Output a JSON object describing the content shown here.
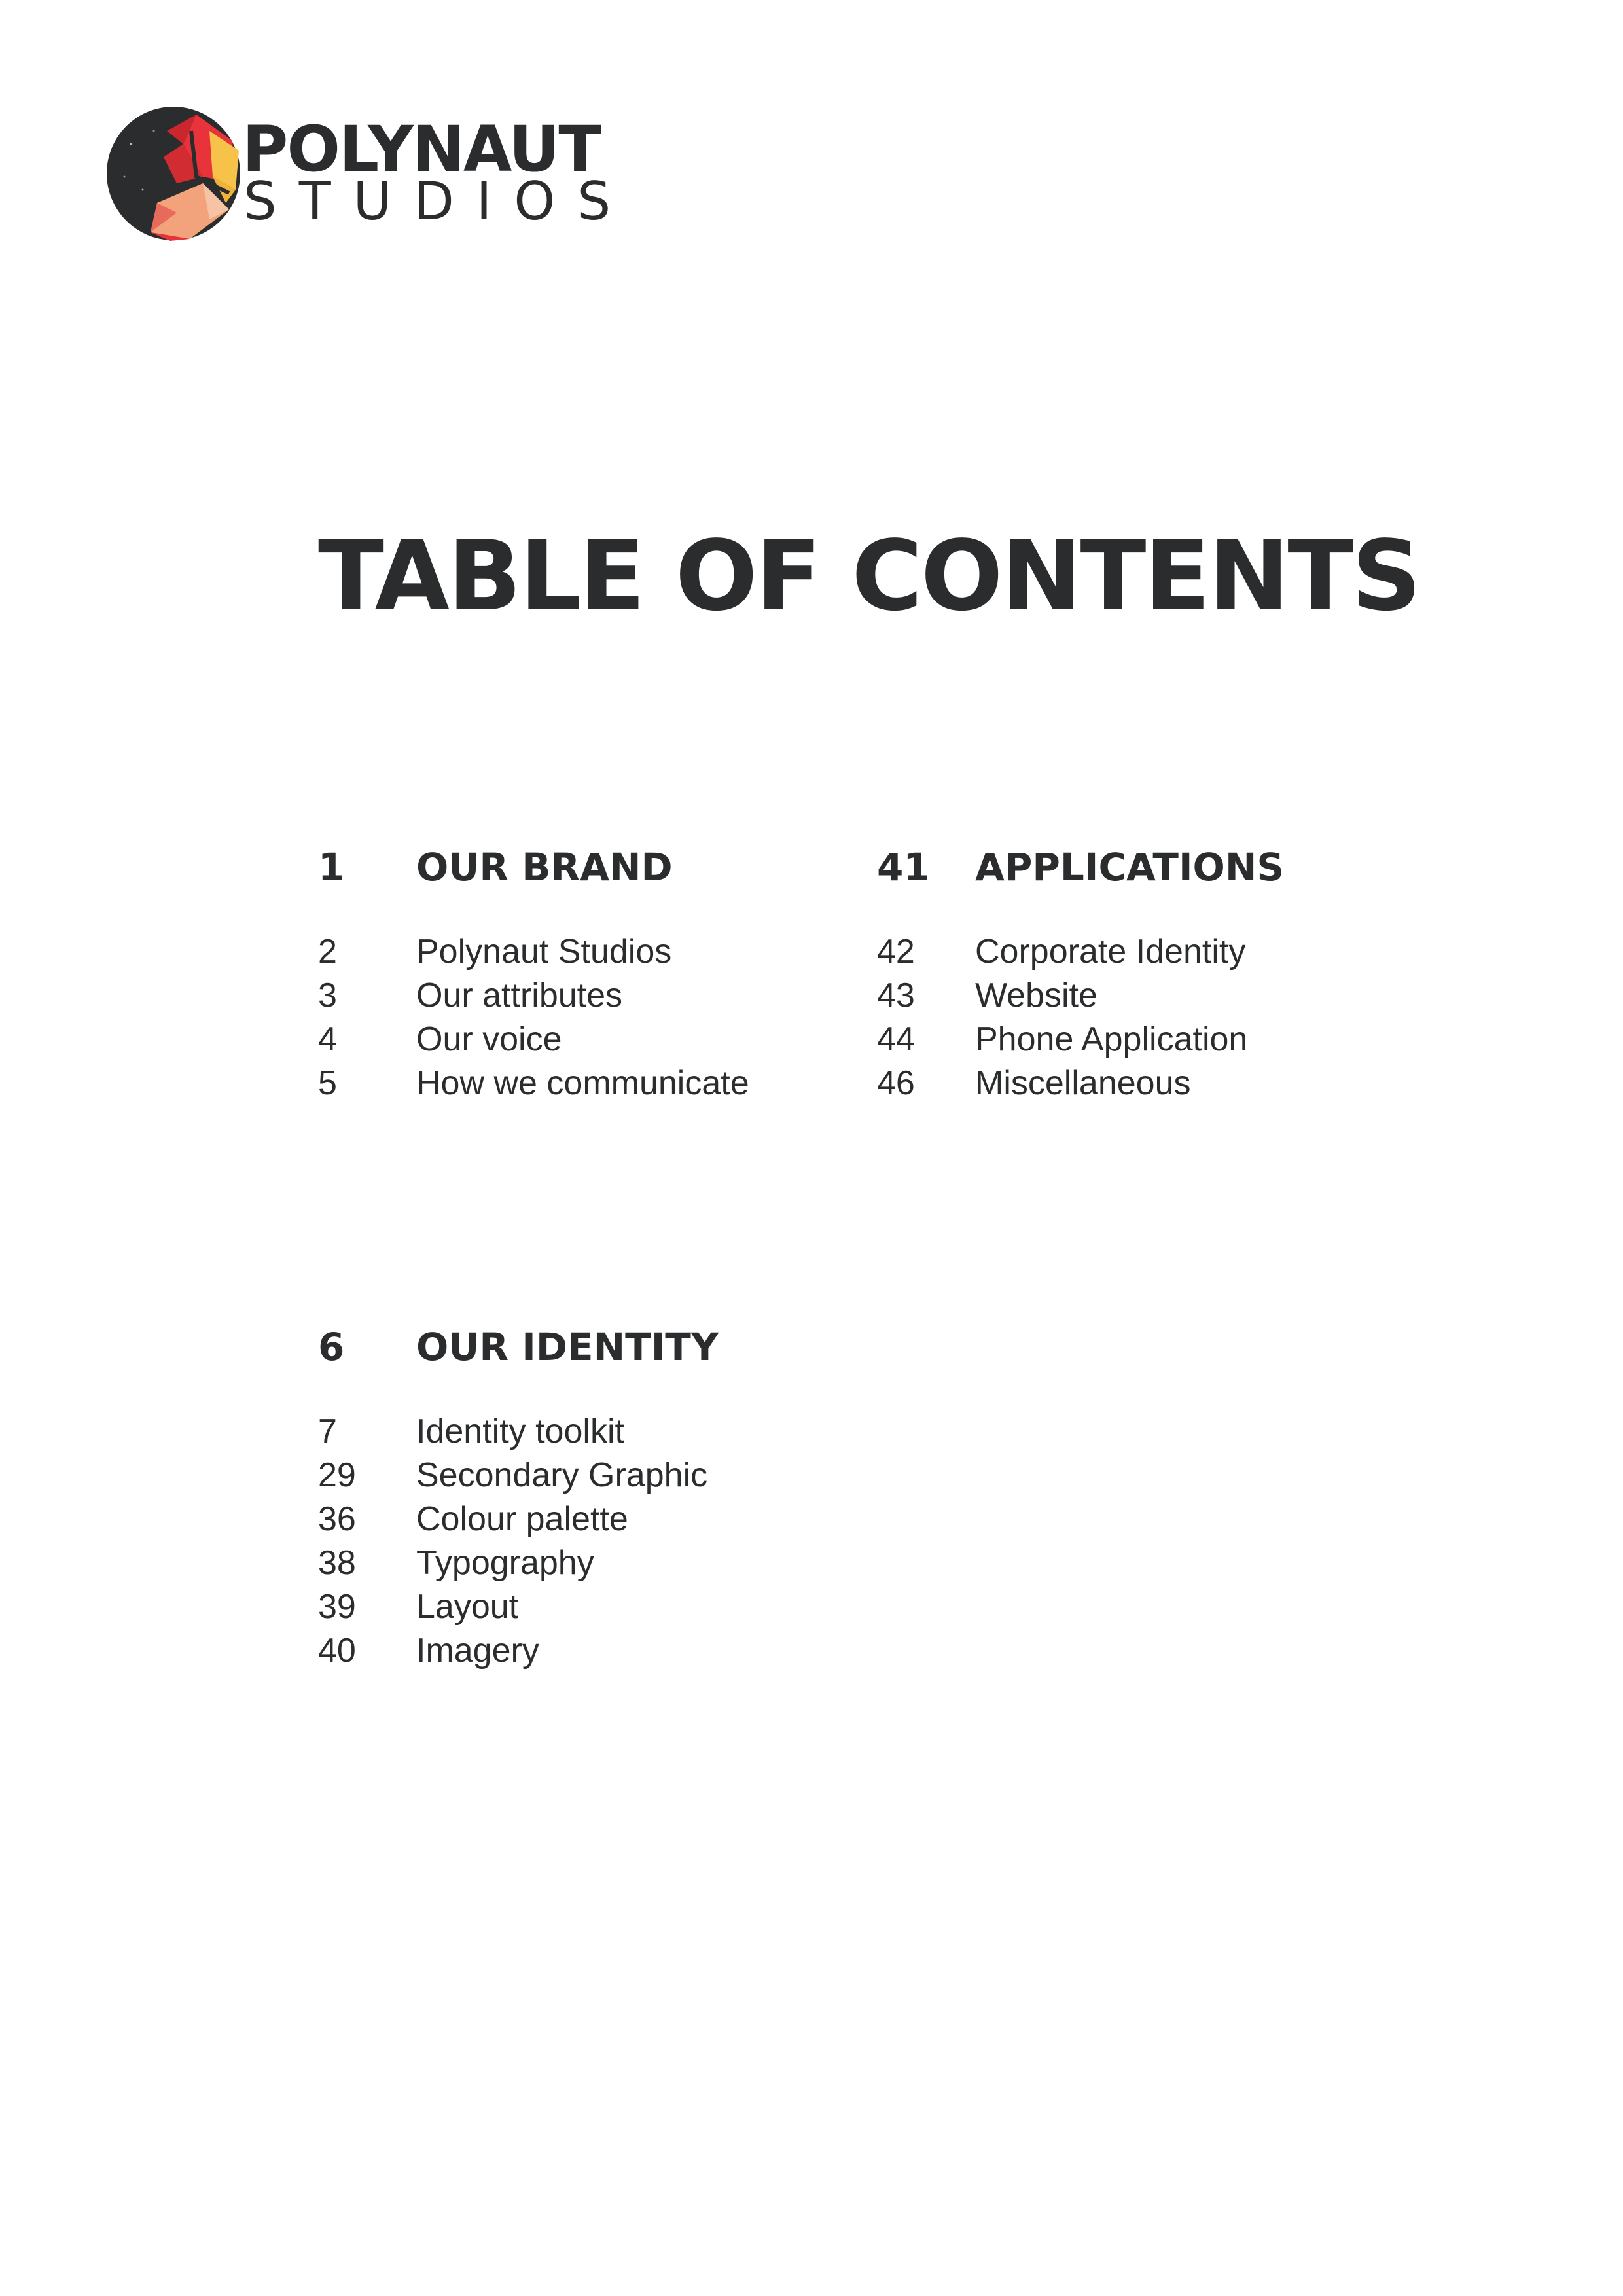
{
  "brand": {
    "name_line1": "POLYNAUT",
    "name_line2": "STUDIOS",
    "colors": {
      "dark": "#2a2c2e",
      "red": "#e8333a",
      "yellow": "#f7c24a",
      "peach": "#f2a37c"
    }
  },
  "title": "TABLE OF CONTENTS",
  "sections": [
    {
      "page": "1",
      "title": "OUR BRAND",
      "items": [
        {
          "page": "2",
          "label": "Polynaut Studios"
        },
        {
          "page": "3",
          "label": "Our attributes"
        },
        {
          "page": "4",
          "label": "Our voice"
        },
        {
          "page": "5",
          "label": "How we communicate"
        }
      ]
    },
    {
      "page": "41",
      "title": "APPLICATIONS",
      "items": [
        {
          "page": "42",
          "label": "Corporate Identity"
        },
        {
          "page": "43",
          "label": "Website"
        },
        {
          "page": "44",
          "label": "Phone Application"
        },
        {
          "page": "46",
          "label": "Miscellaneous"
        }
      ]
    },
    {
      "page": "6",
      "title": "OUR IDENTITY",
      "items": [
        {
          "page": "7",
          "label": "Identity toolkit"
        },
        {
          "page": "29",
          "label": "Secondary Graphic"
        },
        {
          "page": "36",
          "label": "Colour palette"
        },
        {
          "page": "38",
          "label": "Typography"
        },
        {
          "page": "39",
          "label": "Layout"
        },
        {
          "page": "40",
          "label": "Imagery"
        }
      ]
    }
  ]
}
